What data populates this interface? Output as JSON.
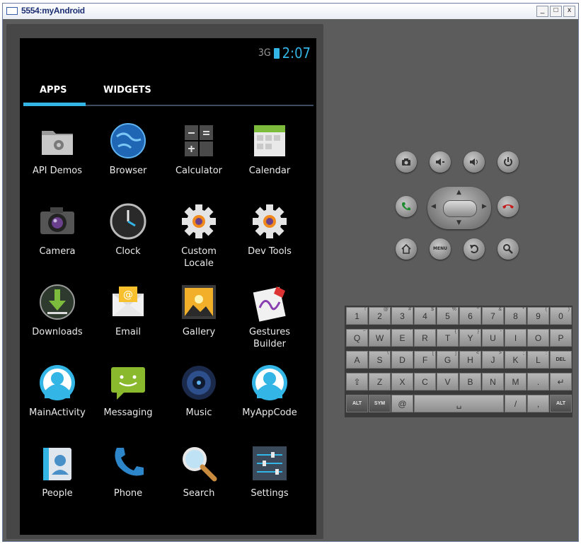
{
  "window": {
    "title": "5554:myAndroid",
    "minimize": "_",
    "maximize": "□",
    "close": "x"
  },
  "status": {
    "signal": "3G",
    "time": "2:07"
  },
  "tabs": {
    "apps": "APPS",
    "widgets": "WIDGETS"
  },
  "apps": [
    {
      "label": "API Demos",
      "icon": "folder-gear-icon"
    },
    {
      "label": "Browser",
      "icon": "globe-icon"
    },
    {
      "label": "Calculator",
      "icon": "calculator-icon"
    },
    {
      "label": "Calendar",
      "icon": "calendar-icon"
    },
    {
      "label": "Camera",
      "icon": "camera-icon"
    },
    {
      "label": "Clock",
      "icon": "clock-icon"
    },
    {
      "label": "Custom\nLocale",
      "icon": "gear-icon"
    },
    {
      "label": "Dev Tools",
      "icon": "gear-icon"
    },
    {
      "label": "Downloads",
      "icon": "download-icon"
    },
    {
      "label": "Email",
      "icon": "envelope-icon"
    },
    {
      "label": "Gallery",
      "icon": "gallery-icon"
    },
    {
      "label": "Gestures\nBuilder",
      "icon": "gestures-icon"
    },
    {
      "label": "MainActivity",
      "icon": "android-face-icon"
    },
    {
      "label": "Messaging",
      "icon": "message-icon"
    },
    {
      "label": "Music",
      "icon": "speaker-icon"
    },
    {
      "label": "MyAppCode",
      "icon": "android-face-icon"
    },
    {
      "label": "People",
      "icon": "contacts-icon"
    },
    {
      "label": "Phone",
      "icon": "phone-icon"
    },
    {
      "label": "Search",
      "icon": "magnifier-icon"
    },
    {
      "label": "Settings",
      "icon": "sliders-icon"
    }
  ],
  "hardware": {
    "menu": "MENU"
  },
  "keyboard": {
    "rows": [
      [
        {
          "k": "1",
          "s": "!"
        },
        {
          "k": "2",
          "s": "@"
        },
        {
          "k": "3",
          "s": "#"
        },
        {
          "k": "4",
          "s": "$"
        },
        {
          "k": "5",
          "s": "%"
        },
        {
          "k": "6",
          "s": "^"
        },
        {
          "k": "7",
          "s": "&"
        },
        {
          "k": "8",
          "s": "*"
        },
        {
          "k": "9",
          "s": "("
        },
        {
          "k": "0",
          "s": ")"
        }
      ],
      [
        {
          "k": "Q",
          "s": "~"
        },
        {
          "k": "W",
          "s": "\""
        },
        {
          "k": "E",
          "s": "'"
        },
        {
          "k": "R",
          "s": ""
        },
        {
          "k": "T",
          "s": "{"
        },
        {
          "k": "Y",
          "s": "}"
        },
        {
          "k": "U",
          "s": "-"
        },
        {
          "k": "I",
          "s": ""
        },
        {
          "k": "O",
          "s": ""
        },
        {
          "k": "P",
          "s": ""
        }
      ],
      [
        {
          "k": "A",
          "s": ""
        },
        {
          "k": "S",
          "s": "\\"
        },
        {
          "k": "D",
          "s": ""
        },
        {
          "k": "F",
          "s": "["
        },
        {
          "k": "G",
          "s": "]"
        },
        {
          "k": "H",
          "s": "<"
        },
        {
          "k": "J",
          "s": ">"
        },
        {
          "k": "K",
          "s": ";"
        },
        {
          "k": "L",
          "s": ":"
        },
        {
          "k": "DEL",
          "s": ""
        }
      ],
      [
        {
          "k": "⇧",
          "s": ""
        },
        {
          "k": "Z",
          "s": ""
        },
        {
          "k": "X",
          "s": ""
        },
        {
          "k": "C",
          "s": ""
        },
        {
          "k": "V",
          "s": ""
        },
        {
          "k": "B",
          "s": ""
        },
        {
          "k": "N",
          "s": ""
        },
        {
          "k": "M",
          "s": ""
        },
        {
          "k": ".",
          "s": ""
        },
        {
          "k": "↵",
          "s": ""
        }
      ]
    ],
    "bottom": {
      "alt_left": "ALT",
      "sym": "SYM",
      "at": "@",
      "space": "␣",
      "slash": "/",
      "question": "?",
      "comma": ",",
      "alt_right": "ALT"
    }
  }
}
